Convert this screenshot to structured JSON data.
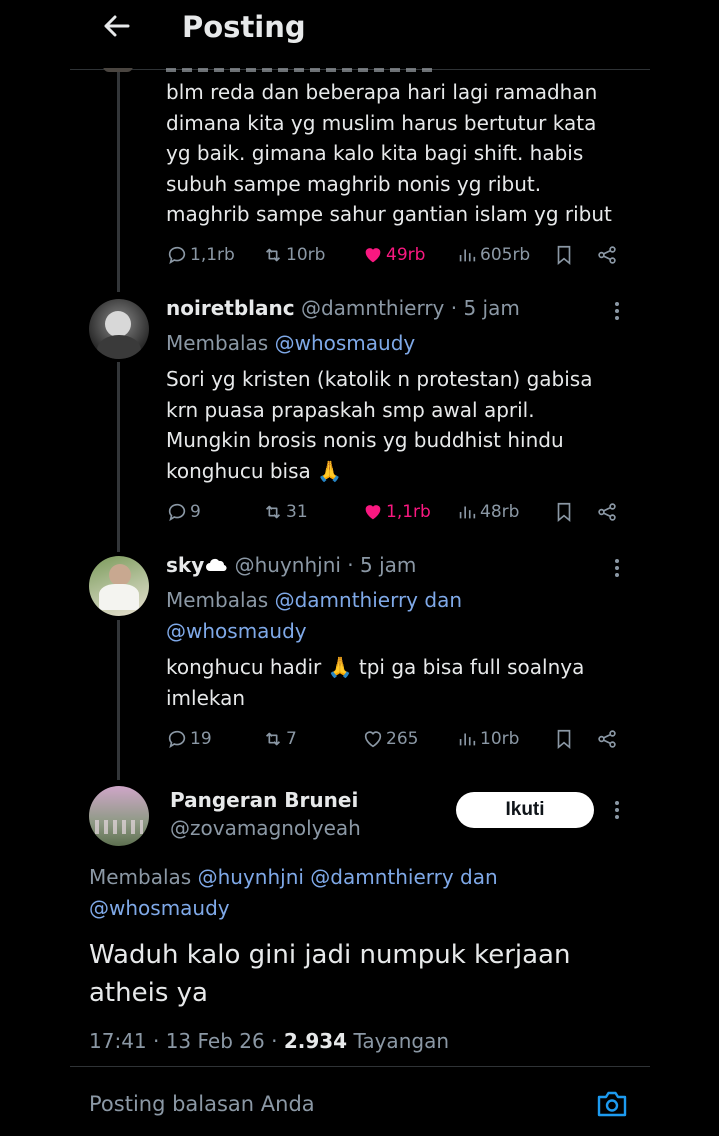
{
  "header": {
    "title": "Posting"
  },
  "tweets": [
    {
      "lines": [
        "blm reda dan beberapa hari lagi ramadhan",
        "dimana kita yg muslim harus bertutur kata",
        "yg baik. gimana kalo kita bagi shift. habis",
        "subuh sampe maghrib nonis yg ribut.",
        "maghrib sampe sahur gantian islam yg ribut"
      ],
      "stats": {
        "replies": "1,1rb",
        "reposts": "10rb",
        "likes": "49rb",
        "views": "605rb"
      }
    },
    {
      "display_name": "noiretblanc",
      "handle": "@damnthierry",
      "time": "· 5 jam",
      "replying_prefix": "Membalas",
      "replying_to": "@whosmaudy",
      "lines": [
        "Sori yg kristen (katolik n protestan) gabisa",
        "krn puasa prapaskah smp awal april.",
        "Mungkin brosis nonis yg buddhist hindu",
        "konghucu bisa 🙏"
      ],
      "stats": {
        "replies": "9",
        "reposts": "31",
        "likes": "1,1rb",
        "views": "48rb"
      }
    },
    {
      "display_name": "sky",
      "handle": "@huynhjni",
      "time": "· 5 jam",
      "replying_prefix": "Membalas",
      "replying_to": "@damnthierry dan",
      "replying_to_2": "@whosmaudy",
      "lines": [
        "konghucu hadir 🙏 tpi ga bisa full soalnya",
        "imlekan"
      ],
      "stats": {
        "replies": "19",
        "reposts": "7",
        "likes": "265",
        "views": "10rb"
      }
    }
  ],
  "main_post": {
    "display_name": "Pangeran Brunei",
    "handle": "@zovamagnolyeah",
    "follow_label": "Ikuti",
    "replying_prefix": "Membalas",
    "replying_to": "@huynhjni @damnthierry dan",
    "replying_to_2": "@whosmaudy",
    "lines": [
      "Waduh kalo gini jadi numpuk kerjaan",
      "atheis ya"
    ],
    "timestamp": "17:41 · 13 Feb 26 ·",
    "views_count": "2.934",
    "views_label": "Tayangan"
  },
  "reply_box": {
    "placeholder": "Posting balasan Anda"
  },
  "colors": {
    "background": "#000000",
    "link": "#7fa9e8",
    "like": "#f91880",
    "muted": "#8b98a5"
  }
}
